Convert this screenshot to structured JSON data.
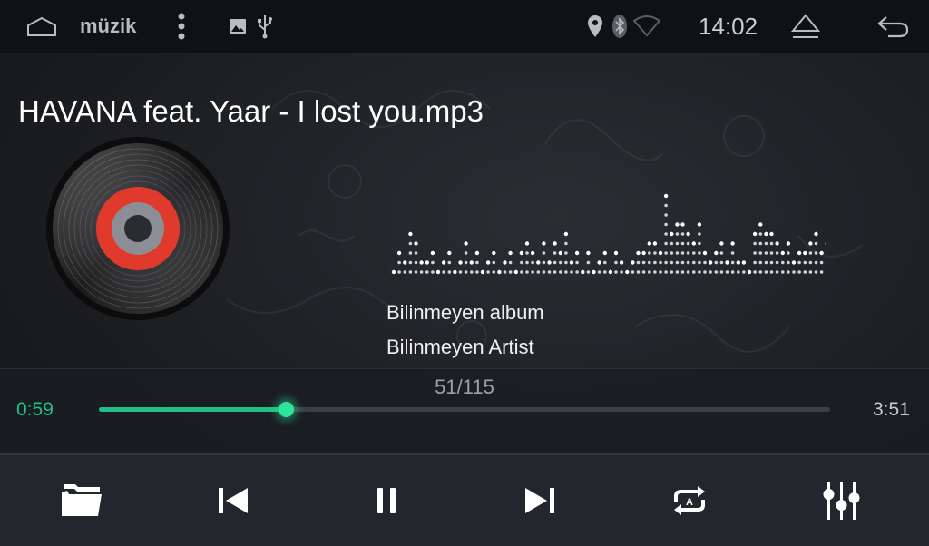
{
  "status_bar": {
    "app_name": "müzik",
    "time": "14:02",
    "icons": [
      "home-icon",
      "more-vert-icon",
      "image-icon",
      "usb-icon",
      "location-icon",
      "bluetooth-icon",
      "wifi-icon",
      "eject-icon",
      "back-icon"
    ]
  },
  "track": {
    "title": "HAVANA feat. Yaar - I lost you.mp3",
    "album": "Bilinmeyen album",
    "artist": "Bilinmeyen Artist",
    "position_text": "51/115"
  },
  "playback": {
    "elapsed": "0:59",
    "duration": "3:51",
    "progress": 0.255,
    "accent_color": "#1fbf86",
    "elapsed_color": "#1fbf86"
  },
  "visualizer": {
    "levels": [
      1,
      3,
      2,
      5,
      4,
      2,
      2,
      3,
      1,
      2,
      3,
      1,
      2,
      4,
      2,
      3,
      1,
      2,
      3,
      1,
      2,
      3,
      1,
      3,
      4,
      3,
      2,
      4,
      2,
      4,
      3,
      5,
      2,
      3,
      1,
      3,
      1,
      2,
      3,
      1,
      3,
      2,
      1,
      2,
      3,
      3,
      4,
      4,
      3,
      9,
      5,
      6,
      6,
      5,
      4,
      6,
      3,
      2,
      3,
      4,
      2,
      4,
      2,
      2,
      1,
      5,
      6,
      5,
      5,
      4,
      3,
      4,
      2,
      3,
      3,
      4,
      5,
      3,
      4,
      5
    ]
  },
  "controls": [
    "folder-icon",
    "previous-icon",
    "pause-icon",
    "next-icon",
    "repeat-all-icon",
    "equalizer-icon"
  ]
}
